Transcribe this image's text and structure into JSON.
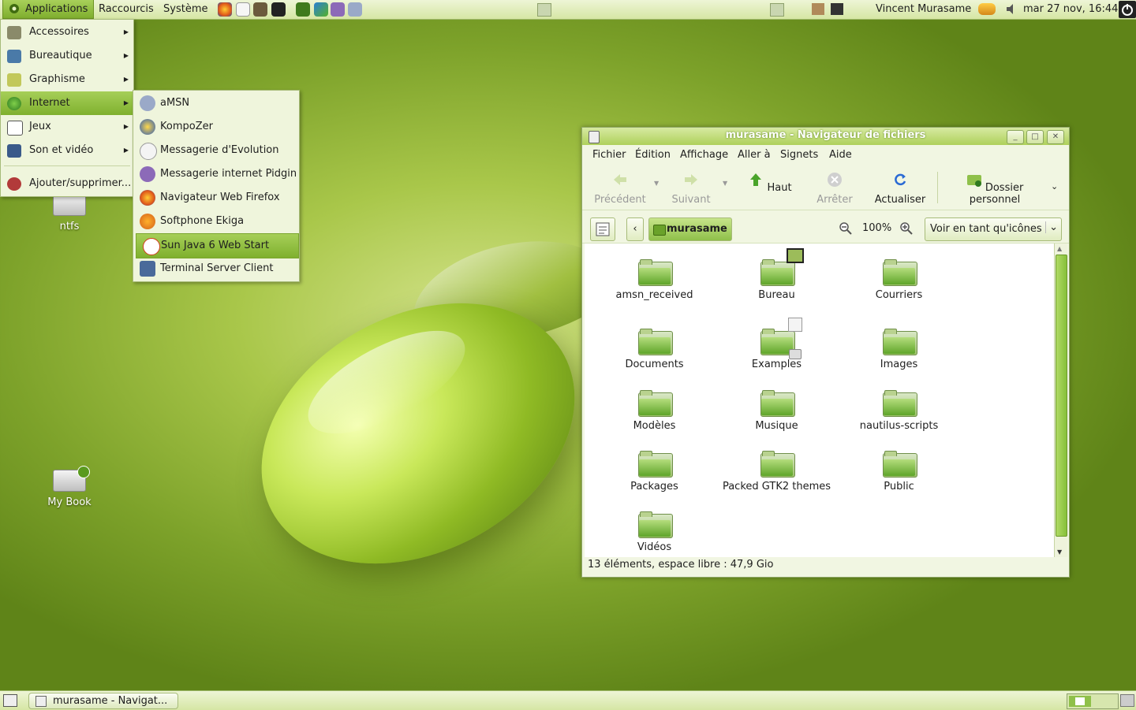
{
  "top_panel": {
    "applications": "Applications",
    "raccourcis": "Raccourcis",
    "systeme": "Système",
    "user": "Vincent Murasame",
    "clock": "mar 27 nov, 16:44"
  },
  "apps_menu": {
    "items": [
      {
        "label": "Accessoires",
        "icon": "accessories-icon"
      },
      {
        "label": "Bureautique",
        "icon": "office-icon"
      },
      {
        "label": "Graphisme",
        "icon": "graphics-icon"
      },
      {
        "label": "Internet",
        "icon": "internet-globe-icon"
      },
      {
        "label": "Jeux",
        "icon": "games-icon"
      },
      {
        "label": "Son et vidéo",
        "icon": "multimedia-icon"
      }
    ],
    "add_remove": "Ajouter/supprimer..."
  },
  "internet_menu": {
    "items": [
      {
        "label": "aMSN",
        "icon": "amsn-icon"
      },
      {
        "label": "KompoZer",
        "icon": "kompozer-icon"
      },
      {
        "label": "Messagerie d'Evolution",
        "icon": "evolution-icon"
      },
      {
        "label": "Messagerie internet Pidgin",
        "icon": "pidgin-icon"
      },
      {
        "label": "Navigateur Web Firefox",
        "icon": "firefox-icon"
      },
      {
        "label": "Softphone Ekiga",
        "icon": "ekiga-icon"
      },
      {
        "label": "Sun Java 6 Web Start",
        "icon": "java-icon"
      },
      {
        "label": "Terminal Server Client",
        "icon": "tsclient-icon"
      }
    ]
  },
  "desktop": {
    "icons": [
      {
        "label": "ntfs"
      },
      {
        "label": "My Book"
      }
    ]
  },
  "window": {
    "title": "murasame - Navigateur de fichiers",
    "menubar": [
      "Fichier",
      "Édition",
      "Affichage",
      "Aller à",
      "Signets",
      "Aide"
    ],
    "toolbar": {
      "back": "Précédent",
      "forward": "Suivant",
      "up": "Haut",
      "stop": "Arrêter",
      "reload": "Actualiser",
      "home": "Dossier personnel"
    },
    "location": {
      "path_button": "murasame",
      "zoom": "100%",
      "view_mode": "Voir en tant qu'icônes"
    },
    "files": [
      {
        "name": "amsn_received"
      },
      {
        "name": "Bureau"
      },
      {
        "name": "Courriers"
      },
      {
        "name": "Documents"
      },
      {
        "name": "Examples"
      },
      {
        "name": "Images"
      },
      {
        "name": "Modèles"
      },
      {
        "name": "Musique"
      },
      {
        "name": "nautilus-scripts"
      },
      {
        "name": "Packages"
      },
      {
        "name": "Packed GTK2 themes"
      },
      {
        "name": "Public"
      },
      {
        "name": "Vidéos"
      }
    ],
    "status": "13 éléments, espace libre : 47,9 Gio"
  },
  "bottom_panel": {
    "task": "murasame - Navigat..."
  },
  "colors": {
    "accent": "#8ab83a",
    "panel": "#e3eec0",
    "desktop": "#7da22a"
  }
}
